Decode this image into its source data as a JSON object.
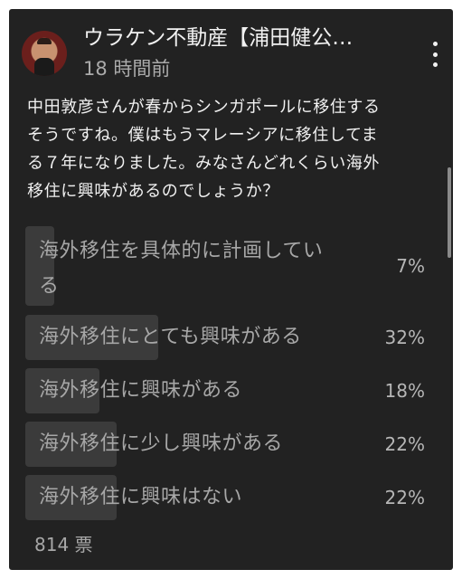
{
  "post": {
    "channel_name": "ウラケン不動産【浦田健公…",
    "time_ago": "18 時間前",
    "text": "中田敦彦さんが春からシンガポールに移住する\nそうですね。僕はもうマレーシアに移住してま\nる７年になりました。みなさんどれくらい海外\n移住に興味があるのでしょうか？"
  },
  "icons": {
    "avatar": "channel-avatar",
    "more": "more-vertical-icon"
  },
  "poll": {
    "options": [
      {
        "label": "海外移住を具体的に計画してい\nる",
        "percent_text": "7%",
        "fraction": 0.07
      },
      {
        "label": "海外移住にとても興味がある",
        "percent_text": "32%",
        "fraction": 0.32
      },
      {
        "label": "海外移住に興味がある",
        "percent_text": "18%",
        "fraction": 0.18
      },
      {
        "label": "海外移住に少し興味がある",
        "percent_text": "22%",
        "fraction": 0.22
      },
      {
        "label": "海外移住に興味はない",
        "percent_text": "22%",
        "fraction": 0.22
      }
    ],
    "vote_count": "814 票"
  },
  "colors": {
    "background": "#222222",
    "primary_text": "#f1f1f1",
    "secondary_text": "#aaaaaa",
    "poll_fill": "#3b3b3b"
  }
}
